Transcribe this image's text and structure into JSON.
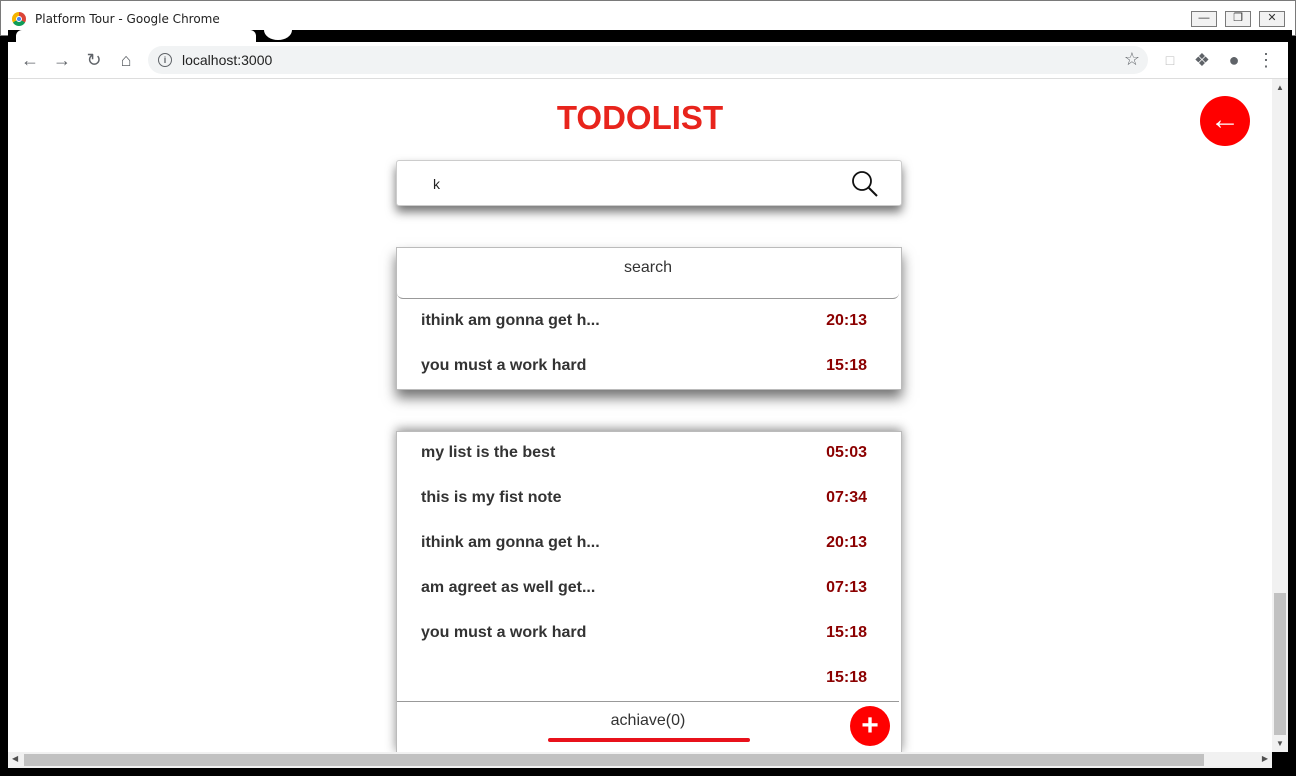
{
  "window": {
    "title": "Platform Tour - Google Chrome"
  },
  "browser": {
    "url": "localhost:3000"
  },
  "colors": {
    "accent": "#ff0000",
    "title": "#e8241c",
    "time": "#8b0000"
  },
  "app": {
    "title": "TODOLIST",
    "search_value": "k",
    "results": {
      "header": "search",
      "items": [
        {
          "text": "ithink am gonna get h...",
          "time": "20:13"
        },
        {
          "text": "you must a work hard",
          "time": "15:18"
        }
      ]
    },
    "list": {
      "items": [
        {
          "text": "my list is the best",
          "time": "05:03"
        },
        {
          "text": "this is my fist note",
          "time": "07:34"
        },
        {
          "text": "ithink am gonna get h...",
          "time": "20:13"
        },
        {
          "text": "am agreet as well get...",
          "time": "07:13"
        },
        {
          "text": "you must a work hard",
          "time": "15:18"
        },
        {
          "text": "",
          "time": "15:18"
        }
      ],
      "footer_label": "achiave(0)",
      "add_icon": "plus-icon"
    },
    "back_icon": "arrow-left-icon"
  }
}
